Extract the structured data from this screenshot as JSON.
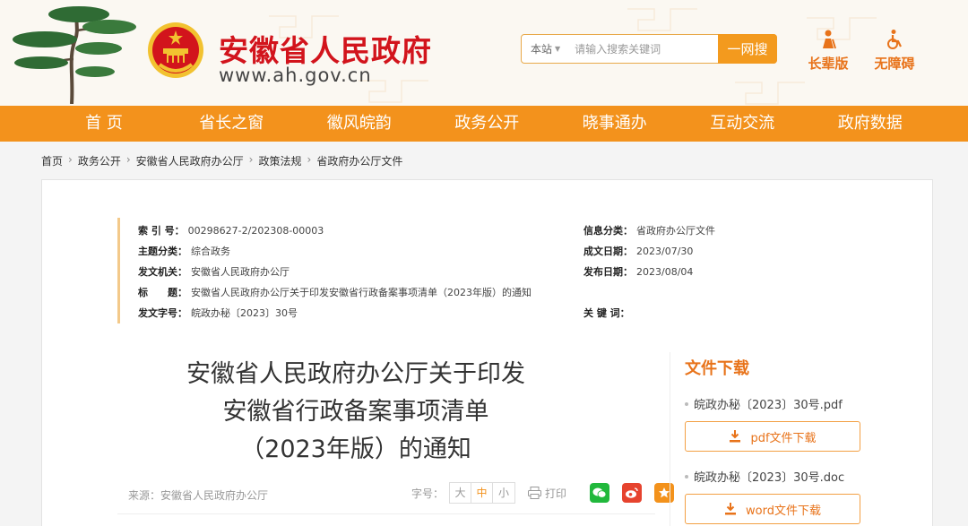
{
  "header": {
    "site_name": "安徽省人民政府",
    "site_url": "www.ah.gov.cn",
    "search": {
      "scope": "本站",
      "placeholder": "请输入搜索关键词",
      "button": "一网搜"
    },
    "modes": [
      {
        "label": "长辈版",
        "icon": "elder-icon"
      },
      {
        "label": "无障碍",
        "icon": "wheelchair-icon"
      }
    ]
  },
  "nav": [
    "首 页",
    "省长之窗",
    "徽风皖韵",
    "政务公开",
    "晓事通办",
    "互动交流",
    "政府数据"
  ],
  "breadcrumb": [
    "首页",
    "政务公开",
    "安徽省人民政府办公厅",
    "政策法规",
    "省政府办公厅文件"
  ],
  "meta": {
    "index": {
      "label": "索 引 号：",
      "value": "00298627-2/202308-00003"
    },
    "topic": {
      "label": "主题分类：",
      "value": "综合政务"
    },
    "issuer": {
      "label": "发文机关：",
      "value": "安徽省人民政府办公厅"
    },
    "title": {
      "label": "标　　题：",
      "value": "安徽省人民政府办公厅关于印发安徽省行政备案事项清单（2023年版）的通知"
    },
    "doc_no": {
      "label": "发文字号：",
      "value": "皖政办秘〔2023〕30号"
    },
    "info_category": {
      "label": "信息分类：",
      "value": "省政府办公厅文件"
    },
    "created": {
      "label": "成文日期：",
      "value": "2023/07/30"
    },
    "published": {
      "label": "发布日期：",
      "value": "2023/08/04"
    },
    "keywords": {
      "label": "关 键 词：",
      "value": ""
    }
  },
  "document": {
    "title_line1": "安徽省人民政府办公厅关于印发",
    "title_line2": "安徽省行政备案事项清单",
    "title_line3": "（2023年版）的通知",
    "source": "来源：安徽省人民政府办公厅",
    "font_size_label": "字号：",
    "font_sizes": [
      "大",
      "中",
      "小"
    ],
    "print": "打印"
  },
  "downloads": {
    "title": "文件下载",
    "files": [
      {
        "name": "皖政办秘〔2023〕30号.pdf",
        "button": "pdf文件下载"
      },
      {
        "name": "皖政办秘〔2023〕30号.doc",
        "button": "word文件下载"
      }
    ]
  },
  "colors": {
    "brand_red": "#d2141c",
    "nav_orange": "#f3921c",
    "accent_orange": "#e8731a"
  }
}
